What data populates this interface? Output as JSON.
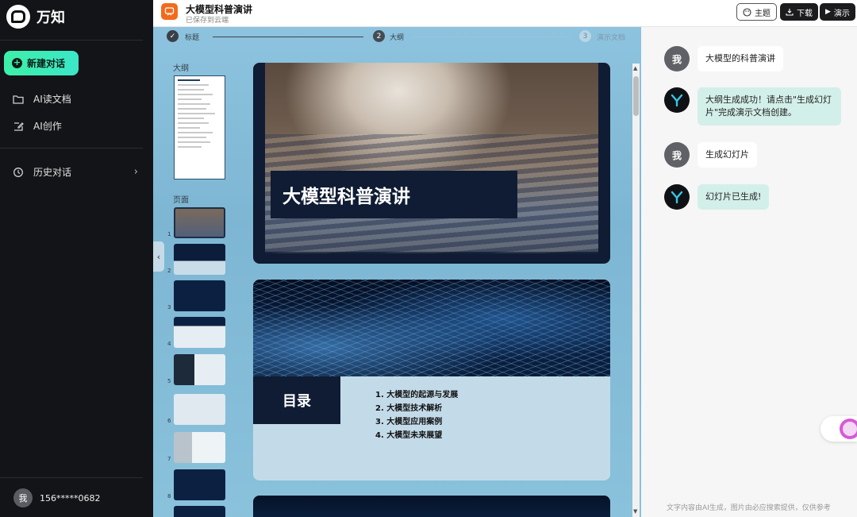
{
  "sidebar": {
    "brand": "万知",
    "new_chat": "新建对话",
    "items": [
      {
        "label": "AI读文档",
        "icon": "folder-icon"
      },
      {
        "label": "AI创作",
        "icon": "edit-icon"
      },
      {
        "label": "历史对话",
        "icon": "history-icon"
      }
    ],
    "user": {
      "avatar": "我",
      "name": "156*****0682"
    }
  },
  "header": {
    "title": "大模型科普演讲",
    "subtitle": "已保存到云端",
    "buttons": {
      "theme": "主题",
      "download": "下载",
      "present": "演示"
    }
  },
  "steps": [
    {
      "num": "✓",
      "label": "标题",
      "state": "done"
    },
    {
      "num": "2",
      "label": "大纲",
      "state": "current"
    },
    {
      "num": "3",
      "label": "演示文档",
      "state": "pending"
    }
  ],
  "panels": {
    "outline": "大纲",
    "pages": "页面"
  },
  "thumbnails": [
    "1",
    "2",
    "3",
    "4",
    "5",
    "6",
    "7",
    "8"
  ],
  "slides": {
    "slide1_title": "大模型科普演讲",
    "slide2_heading": "目录",
    "toc": [
      "1.  大模型的起源与发展",
      "2.  大模型技术解析",
      "3.  大模型应用案例",
      "4.  大模型未来展望"
    ]
  },
  "chat": {
    "messages": [
      {
        "from": "me",
        "avatar": "我",
        "text": "大模型的科普演讲"
      },
      {
        "from": "bot",
        "text": "大纲生成成功！请点击\"生成幻灯片\"完成演示文档创建。"
      },
      {
        "from": "me",
        "avatar": "我",
        "text": "生成幻灯片"
      },
      {
        "from": "bot",
        "text": "幻灯片已生成!"
      }
    ],
    "footnote": "文字内容由AI生成，图片由必应搜索提供，仅供参考"
  },
  "colors": {
    "accent": "#3df0a8",
    "sidebar_bg": "#131417",
    "doc_icon": "#f26b1d",
    "bot_bubble": "#d3efe9"
  }
}
